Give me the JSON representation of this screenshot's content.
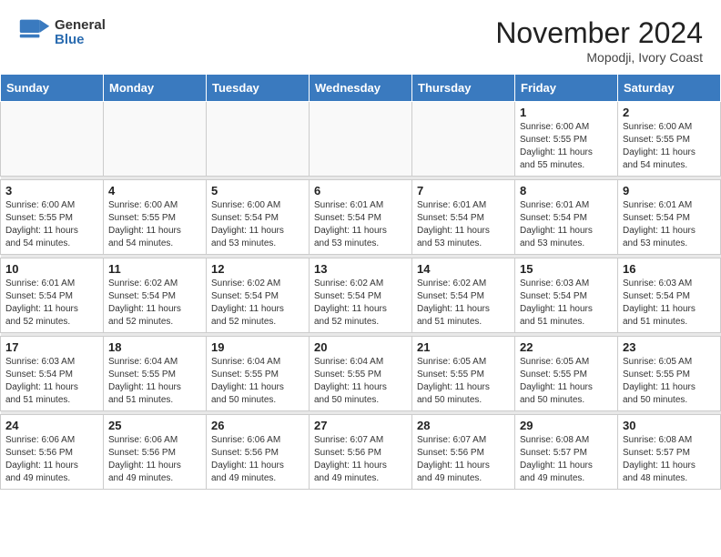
{
  "header": {
    "logo_general": "General",
    "logo_blue": "Blue",
    "month_title": "November 2024",
    "location": "Mopodji, Ivory Coast"
  },
  "days_of_week": [
    "Sunday",
    "Monday",
    "Tuesday",
    "Wednesday",
    "Thursday",
    "Friday",
    "Saturday"
  ],
  "weeks": [
    {
      "days": [
        {
          "num": "",
          "info": ""
        },
        {
          "num": "",
          "info": ""
        },
        {
          "num": "",
          "info": ""
        },
        {
          "num": "",
          "info": ""
        },
        {
          "num": "",
          "info": ""
        },
        {
          "num": "1",
          "info": "Sunrise: 6:00 AM\nSunset: 5:55 PM\nDaylight: 11 hours\nand 55 minutes."
        },
        {
          "num": "2",
          "info": "Sunrise: 6:00 AM\nSunset: 5:55 PM\nDaylight: 11 hours\nand 54 minutes."
        }
      ]
    },
    {
      "days": [
        {
          "num": "3",
          "info": "Sunrise: 6:00 AM\nSunset: 5:55 PM\nDaylight: 11 hours\nand 54 minutes."
        },
        {
          "num": "4",
          "info": "Sunrise: 6:00 AM\nSunset: 5:55 PM\nDaylight: 11 hours\nand 54 minutes."
        },
        {
          "num": "5",
          "info": "Sunrise: 6:00 AM\nSunset: 5:54 PM\nDaylight: 11 hours\nand 53 minutes."
        },
        {
          "num": "6",
          "info": "Sunrise: 6:01 AM\nSunset: 5:54 PM\nDaylight: 11 hours\nand 53 minutes."
        },
        {
          "num": "7",
          "info": "Sunrise: 6:01 AM\nSunset: 5:54 PM\nDaylight: 11 hours\nand 53 minutes."
        },
        {
          "num": "8",
          "info": "Sunrise: 6:01 AM\nSunset: 5:54 PM\nDaylight: 11 hours\nand 53 minutes."
        },
        {
          "num": "9",
          "info": "Sunrise: 6:01 AM\nSunset: 5:54 PM\nDaylight: 11 hours\nand 53 minutes."
        }
      ]
    },
    {
      "days": [
        {
          "num": "10",
          "info": "Sunrise: 6:01 AM\nSunset: 5:54 PM\nDaylight: 11 hours\nand 52 minutes."
        },
        {
          "num": "11",
          "info": "Sunrise: 6:02 AM\nSunset: 5:54 PM\nDaylight: 11 hours\nand 52 minutes."
        },
        {
          "num": "12",
          "info": "Sunrise: 6:02 AM\nSunset: 5:54 PM\nDaylight: 11 hours\nand 52 minutes."
        },
        {
          "num": "13",
          "info": "Sunrise: 6:02 AM\nSunset: 5:54 PM\nDaylight: 11 hours\nand 52 minutes."
        },
        {
          "num": "14",
          "info": "Sunrise: 6:02 AM\nSunset: 5:54 PM\nDaylight: 11 hours\nand 51 minutes."
        },
        {
          "num": "15",
          "info": "Sunrise: 6:03 AM\nSunset: 5:54 PM\nDaylight: 11 hours\nand 51 minutes."
        },
        {
          "num": "16",
          "info": "Sunrise: 6:03 AM\nSunset: 5:54 PM\nDaylight: 11 hours\nand 51 minutes."
        }
      ]
    },
    {
      "days": [
        {
          "num": "17",
          "info": "Sunrise: 6:03 AM\nSunset: 5:54 PM\nDaylight: 11 hours\nand 51 minutes."
        },
        {
          "num": "18",
          "info": "Sunrise: 6:04 AM\nSunset: 5:55 PM\nDaylight: 11 hours\nand 51 minutes."
        },
        {
          "num": "19",
          "info": "Sunrise: 6:04 AM\nSunset: 5:55 PM\nDaylight: 11 hours\nand 50 minutes."
        },
        {
          "num": "20",
          "info": "Sunrise: 6:04 AM\nSunset: 5:55 PM\nDaylight: 11 hours\nand 50 minutes."
        },
        {
          "num": "21",
          "info": "Sunrise: 6:05 AM\nSunset: 5:55 PM\nDaylight: 11 hours\nand 50 minutes."
        },
        {
          "num": "22",
          "info": "Sunrise: 6:05 AM\nSunset: 5:55 PM\nDaylight: 11 hours\nand 50 minutes."
        },
        {
          "num": "23",
          "info": "Sunrise: 6:05 AM\nSunset: 5:55 PM\nDaylight: 11 hours\nand 50 minutes."
        }
      ]
    },
    {
      "days": [
        {
          "num": "24",
          "info": "Sunrise: 6:06 AM\nSunset: 5:56 PM\nDaylight: 11 hours\nand 49 minutes."
        },
        {
          "num": "25",
          "info": "Sunrise: 6:06 AM\nSunset: 5:56 PM\nDaylight: 11 hours\nand 49 minutes."
        },
        {
          "num": "26",
          "info": "Sunrise: 6:06 AM\nSunset: 5:56 PM\nDaylight: 11 hours\nand 49 minutes."
        },
        {
          "num": "27",
          "info": "Sunrise: 6:07 AM\nSunset: 5:56 PM\nDaylight: 11 hours\nand 49 minutes."
        },
        {
          "num": "28",
          "info": "Sunrise: 6:07 AM\nSunset: 5:56 PM\nDaylight: 11 hours\nand 49 minutes."
        },
        {
          "num": "29",
          "info": "Sunrise: 6:08 AM\nSunset: 5:57 PM\nDaylight: 11 hours\nand 49 minutes."
        },
        {
          "num": "30",
          "info": "Sunrise: 6:08 AM\nSunset: 5:57 PM\nDaylight: 11 hours\nand 48 minutes."
        }
      ]
    }
  ]
}
